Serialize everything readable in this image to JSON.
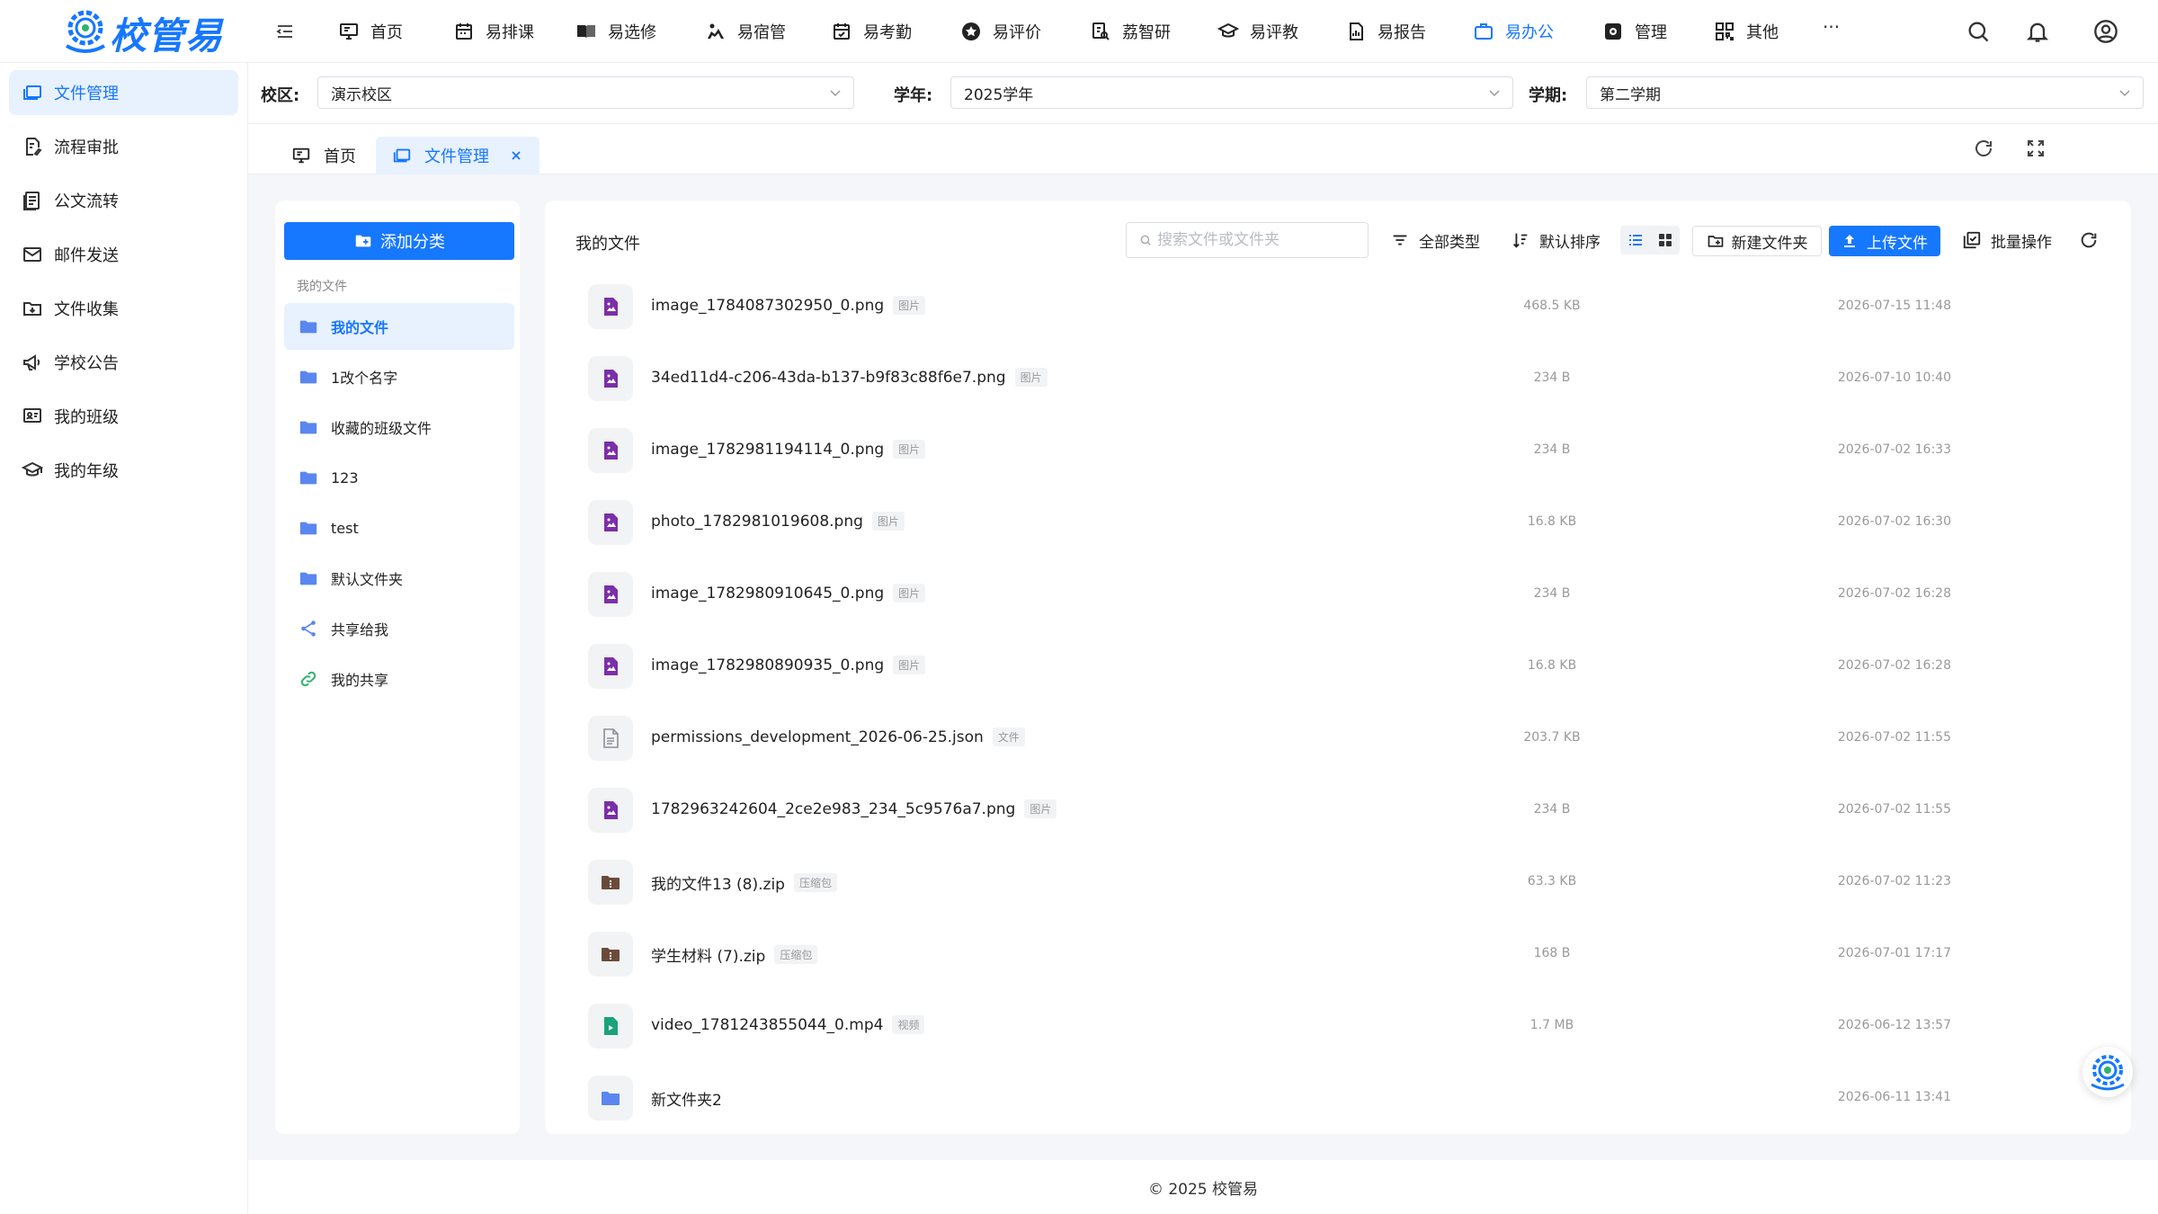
{
  "app": {
    "name": "校管易",
    "brand_color": "#1677ff"
  },
  "nav": {
    "items": [
      {
        "label": "首页",
        "icon": "monitor-icon",
        "active": false
      },
      {
        "label": "易排课",
        "icon": "calendar-icon",
        "active": false
      },
      {
        "label": "易选修",
        "icon": "book-icon",
        "active": false
      },
      {
        "label": "易宿管",
        "icon": "bed-icon",
        "active": false
      },
      {
        "label": "易考勤",
        "icon": "calendar-check-icon",
        "active": false
      },
      {
        "label": "易评价",
        "icon": "star-badge-icon",
        "active": false
      },
      {
        "label": "荔智研",
        "icon": "research-icon",
        "active": false
      },
      {
        "label": "易评教",
        "icon": "graduation-cap-icon",
        "active": false
      },
      {
        "label": "易报告",
        "icon": "report-icon",
        "active": false
      },
      {
        "label": "易办公",
        "icon": "briefcase-icon",
        "active": true
      },
      {
        "label": "管理",
        "icon": "settings-icon",
        "active": false
      },
      {
        "label": "其他",
        "icon": "apps-icon",
        "active": false
      }
    ],
    "more": "···"
  },
  "sidebar": {
    "items": [
      {
        "label": "文件管理",
        "icon": "folder-window-icon",
        "active": true
      },
      {
        "label": "流程审批",
        "icon": "approval-icon",
        "active": false
      },
      {
        "label": "公文流转",
        "icon": "document-icon",
        "active": false
      },
      {
        "label": "邮件发送",
        "icon": "mail-icon",
        "active": false
      },
      {
        "label": "文件收集",
        "icon": "folder-collect-icon",
        "active": false
      },
      {
        "label": "学校公告",
        "icon": "megaphone-icon",
        "active": false
      },
      {
        "label": "我的班级",
        "icon": "class-icon",
        "active": false
      },
      {
        "label": "我的年级",
        "icon": "grade-icon",
        "active": false
      }
    ]
  },
  "filters": {
    "campus_label": "校区:",
    "campus_value": "演示校区",
    "year_label": "学年:",
    "year_value": "2025学年",
    "term_label": "学期:",
    "term_value": "第二学期"
  },
  "tabs": [
    {
      "label": "首页",
      "active": false
    },
    {
      "label": "文件管理",
      "active": true
    }
  ],
  "categories": {
    "add_button": "添加分类",
    "section_title": "我的文件",
    "items": [
      {
        "label": "我的文件",
        "icon": "folder-icon",
        "active": true
      },
      {
        "label": "1改个名字",
        "icon": "folder-icon",
        "active": false
      },
      {
        "label": "收藏的班级文件",
        "icon": "folder-icon",
        "active": false
      },
      {
        "label": "123",
        "icon": "folder-icon",
        "active": false
      },
      {
        "label": "test",
        "icon": "folder-icon",
        "active": false
      },
      {
        "label": "默认文件夹",
        "icon": "folder-icon",
        "active": false
      },
      {
        "label": "共享给我",
        "icon": "share-icon",
        "active": false
      },
      {
        "label": "我的共享",
        "icon": "link-icon",
        "active": false
      }
    ]
  },
  "file_panel": {
    "title": "我的文件",
    "search_placeholder": "搜索文件或文件夹",
    "filter_type": "全部类型",
    "sort": "默认排序",
    "new_folder": "新建文件夹",
    "upload": "上传文件",
    "batch": "批量操作",
    "files": [
      {
        "name": "image_1784087302950_0.png",
        "tag": "图片",
        "size": "468.5 KB",
        "date": "2026-07-15 11:48",
        "kind": "image"
      },
      {
        "name": "34ed11d4-c206-43da-b137-b9f83c88f6e7.png",
        "tag": "图片",
        "size": "234 B",
        "date": "2026-07-10 10:40",
        "kind": "image"
      },
      {
        "name": "image_1782981194114_0.png",
        "tag": "图片",
        "size": "234 B",
        "date": "2026-07-02 16:33",
        "kind": "image"
      },
      {
        "name": "photo_1782981019608.png",
        "tag": "图片",
        "size": "16.8 KB",
        "date": "2026-07-02 16:30",
        "kind": "image"
      },
      {
        "name": "image_1782980910645_0.png",
        "tag": "图片",
        "size": "234 B",
        "date": "2026-07-02 16:28",
        "kind": "image"
      },
      {
        "name": "image_1782980890935_0.png",
        "tag": "图片",
        "size": "16.8 KB",
        "date": "2026-07-02 16:28",
        "kind": "image"
      },
      {
        "name": "permissions_development_2026-06-25.json",
        "tag": "文件",
        "size": "203.7 KB",
        "date": "2026-07-02 11:55",
        "kind": "file"
      },
      {
        "name": "1782963242604_2ce2e983_234_5c9576a7.png",
        "tag": "图片",
        "size": "234 B",
        "date": "2026-07-02 11:55",
        "kind": "image"
      },
      {
        "name": "我的文件13 (8).zip",
        "tag": "压缩包",
        "size": "63.3 KB",
        "date": "2026-07-02 11:23",
        "kind": "zip"
      },
      {
        "name": "学生材料 (7).zip",
        "tag": "压缩包",
        "size": "168 B",
        "date": "2026-07-01 17:17",
        "kind": "zip"
      },
      {
        "name": "video_1781243855044_0.mp4",
        "tag": "视频",
        "size": "1.7 MB",
        "date": "2026-06-12 13:57",
        "kind": "video"
      },
      {
        "name": "新文件夹2",
        "tag": "",
        "size": "",
        "date": "2026-06-11 13:41",
        "kind": "folder"
      }
    ]
  },
  "footer": "© 2025 校管易",
  "colors": {
    "image": "#7b2fa8",
    "file": "#8a8f99",
    "zip": "#6b4a3a",
    "video": "#19a37a",
    "folder": "#5a86f0"
  }
}
